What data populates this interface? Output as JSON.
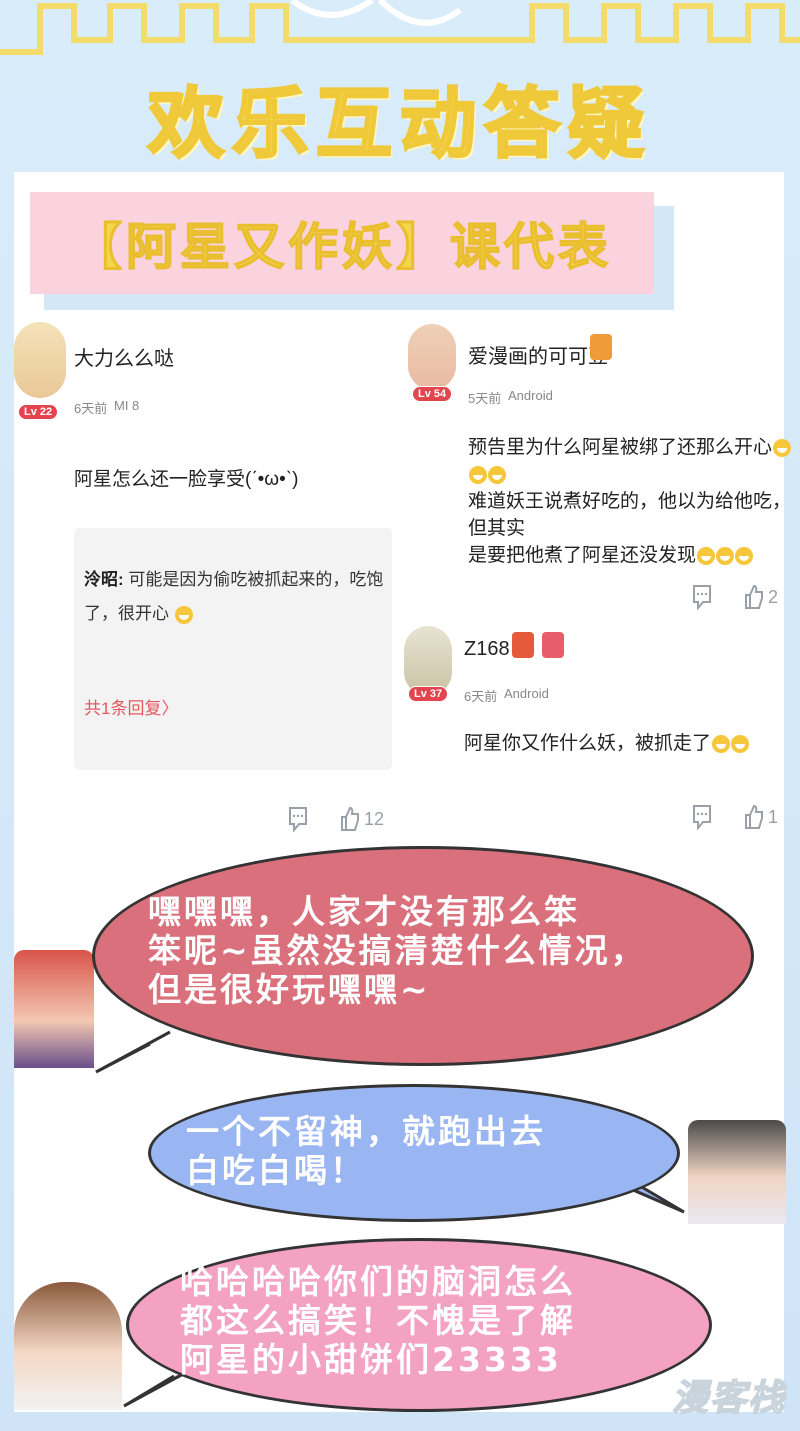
{
  "header": {
    "title": "欢乐互动答疑"
  },
  "course": {
    "label": "【阿星又作妖】课代表"
  },
  "comments": [
    {
      "user": "大力么么哒",
      "level": "Lv 22",
      "time": "6天前",
      "device": "MI 8",
      "text": "阿星怎么还一脸享受(ˊ•ω•ˋ)",
      "reply": {
        "name": "泠昭:",
        "text": "可能是因为偷吃被抓起来的，吃饱了，很开心",
        "more": "共1条回复〉"
      },
      "likes": "12"
    },
    {
      "user": "爱漫画的可可豆",
      "level": "Lv 54",
      "time": "5天前",
      "device": "Android",
      "text_lines": [
        "预告里为什么阿星被绑了还那么开心",
        "难道妖王说煮好吃的，他以为给他吃，但其实",
        "是要把他煮了阿星还没发现"
      ],
      "likes": "2"
    },
    {
      "user": "Z168",
      "level": "Lv 37",
      "time": "6天前",
      "device": "Android",
      "text": "阿星你又作什么妖，被抓走了",
      "likes": "1"
    }
  ],
  "bubbles": [
    {
      "lines": [
        "嘿嘿嘿，人家才没有那么笨",
        "笨呢~虽然没搞清楚什么情况，",
        "但是很好玩嘿嘿~"
      ],
      "color": "#d9707b"
    },
    {
      "lines": [
        "一个不留神，就跑出去",
        "白吃白喝！"
      ],
      "color": "#9ab6f2"
    },
    {
      "lines": [
        "哈哈哈哈你们的脑洞怎么",
        "都这么搞笑！不愧是了解",
        "阿星的小甜饼们23333"
      ],
      "color": "#f3a2c1"
    }
  ],
  "watermark": "漫客栈",
  "icons": {
    "comment": "comment-bubble-icon",
    "like": "thumbs-up-icon",
    "emoji": "laughing-emoji-icon"
  }
}
